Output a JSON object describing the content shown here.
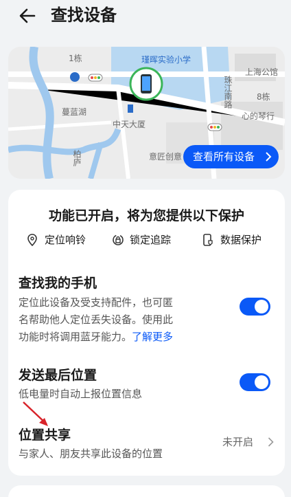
{
  "header": {
    "title": "查找设备",
    "back_icon": "back-arrow-icon"
  },
  "map": {
    "labels": {
      "school": "瑾晖实验小学",
      "building": "中天大厦",
      "library": "上海公馆",
      "road": "珠江南路",
      "lane": "心的琴行",
      "bldg8": "8栋",
      "bldg1": "1栋",
      "misc": "蔓蓝湖",
      "creative": "意匠创意",
      "left_road": "柏庐"
    },
    "device_icon": "phone-icon",
    "see_all_label": "查看所有设备"
  },
  "protection": {
    "title": "功能已开启，将为您提供以下保护",
    "features": [
      {
        "label": "定位响铃",
        "icon": "location-pin-icon"
      },
      {
        "label": "锁定追踪",
        "icon": "lock-track-icon"
      },
      {
        "label": "数据保护",
        "icon": "phone-shield-icon"
      }
    ]
  },
  "find_phone": {
    "title": "查找我的手机",
    "desc_lines": [
      "定位此设备及受支持配件，也可匿",
      "名帮助他人定位丢失设备。使用此",
      "功能时将调用蓝牙能力。"
    ],
    "link": "了解更多",
    "enabled": true
  },
  "last_location": {
    "title": "发送最后位置",
    "desc": "低电量时自动上报位置信息",
    "enabled": true
  },
  "location_sharing": {
    "title": "位置共享",
    "desc": "与家人、朋友共享此设备的位置",
    "status": "未开启"
  },
  "colors": {
    "accent": "#0a59f7",
    "background": "#f1f3f5",
    "card": "#ffffff"
  }
}
